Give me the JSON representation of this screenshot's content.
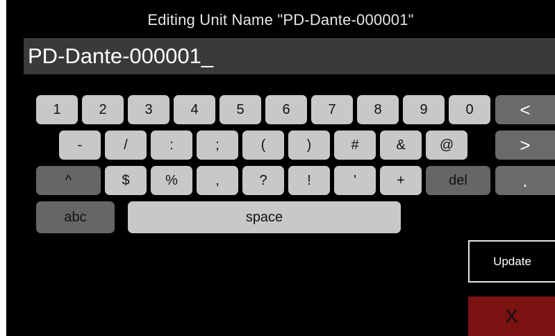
{
  "header": {
    "title": "Editing Unit Name \"PD-Dante-000001\""
  },
  "name_field": {
    "value": "PD-Dante-000001_"
  },
  "keyboard": {
    "row1": [
      "1",
      "2",
      "3",
      "4",
      "5",
      "6",
      "7",
      "8",
      "9",
      "0"
    ],
    "row2": [
      "-",
      "/",
      ":",
      ";",
      "(",
      ")",
      "#",
      "&",
      "@"
    ],
    "row3": [
      "^",
      "$",
      "%",
      ",",
      "?",
      "!",
      "'",
      "+",
      "del"
    ],
    "abc": "abc",
    "space": "space",
    "side": {
      "left": "<",
      "right": ">",
      "period": "."
    }
  },
  "actions": {
    "update": "Update",
    "cancel": "X"
  },
  "colors": {
    "key": "#c8c8c8",
    "key_dark": "#666666",
    "cancel_bg": "#7a1212",
    "field_bg": "#3a3a3a"
  }
}
